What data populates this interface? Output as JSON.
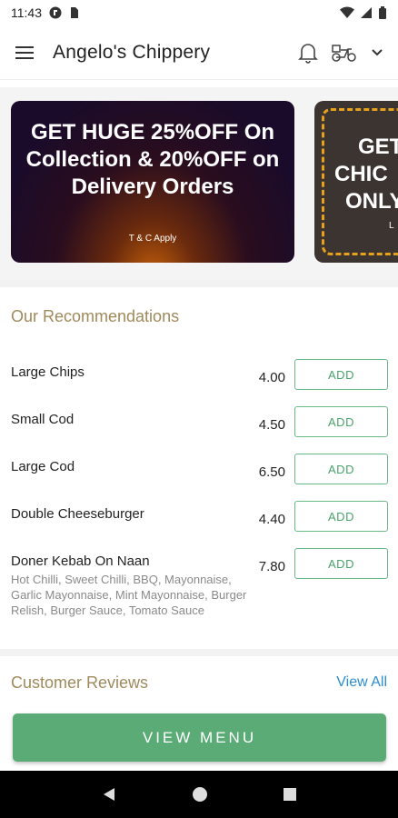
{
  "status_bar": {
    "time": "11:43"
  },
  "app_bar": {
    "title": "Angelo's Chippery"
  },
  "banners": [
    {
      "headline": "GET HUGE 25%OFF On Collection & 20%OFF on Delivery Orders",
      "footnote": "T & C Apply"
    },
    {
      "headline_lines": [
        "GET",
        "CHIC",
        "ONLY"
      ],
      "footnote": "L"
    }
  ],
  "recommendations": {
    "title": "Our Recommendations",
    "add_label": "ADD",
    "items": [
      {
        "name": "Large Chips",
        "price": "4.00",
        "description": ""
      },
      {
        "name": "Small Cod",
        "price": "4.50",
        "description": ""
      },
      {
        "name": "Large Cod",
        "price": "6.50",
        "description": ""
      },
      {
        "name": "Double Cheeseburger",
        "price": "4.40",
        "description": ""
      },
      {
        "name": "Doner Kebab On Naan",
        "price": "7.80",
        "description": "Hot Chilli, Sweet Chilli, BBQ, Mayonnaise, Garlic Mayonnaise, Mint Mayonnaise, Burger Relish, Burger Sauce, Tomato Sauce"
      }
    ]
  },
  "reviews": {
    "title": "Customer Reviews",
    "view_all": "View All"
  },
  "view_menu_label": "VIEW MENU",
  "colors": {
    "accent_green": "#5aab76",
    "section_title": "#a08a5c",
    "link_blue": "#2b8fcf",
    "banner_dash": "#e6a11d"
  },
  "icons": [
    "menu-icon",
    "bell-icon",
    "scooter-icon",
    "chevron-down-icon",
    "back-icon",
    "home-icon",
    "recents-icon"
  ]
}
